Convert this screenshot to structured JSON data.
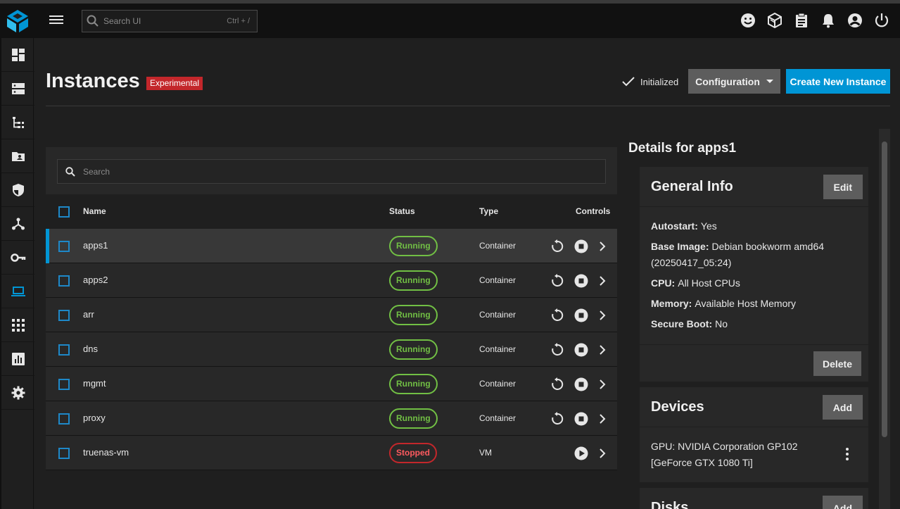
{
  "topbar": {
    "search_placeholder": "Search UI",
    "search_shortcut": "Ctrl + /"
  },
  "header": {
    "title": "Instances",
    "badge": "Experimental",
    "status": "Initialized",
    "config_button": "Configuration",
    "create_button": "Create New Instance"
  },
  "list": {
    "search_placeholder": "Search",
    "columns": {
      "name": "Name",
      "status": "Status",
      "type": "Type",
      "controls": "Controls"
    },
    "rows": [
      {
        "name": "apps1",
        "status": "Running",
        "type": "Container"
      },
      {
        "name": "apps2",
        "status": "Running",
        "type": "Container"
      },
      {
        "name": "arr",
        "status": "Running",
        "type": "Container"
      },
      {
        "name": "dns",
        "status": "Running",
        "type": "Container"
      },
      {
        "name": "mgmt",
        "status": "Running",
        "type": "Container"
      },
      {
        "name": "proxy",
        "status": "Running",
        "type": "Container"
      },
      {
        "name": "truenas-vm",
        "status": "Stopped",
        "type": "VM"
      }
    ]
  },
  "details": {
    "title": "Details for apps1",
    "general": {
      "title": "General Info",
      "edit_button": "Edit",
      "autostart_label": "Autostart:",
      "autostart_value": "Yes",
      "image_label": "Base Image:",
      "image_value": "Debian bookworm amd64 (20250417_05:24)",
      "cpu_label": "CPU:",
      "cpu_value": "All Host CPUs",
      "memory_label": "Memory:",
      "memory_value": "Available Host Memory",
      "secureboot_label": "Secure Boot:",
      "secureboot_value": "No",
      "delete_button": "Delete"
    },
    "devices": {
      "title": "Devices",
      "add_button": "Add",
      "item": "GPU: NVIDIA Corporation GP102 [GeForce GTX 1080 Ti]"
    },
    "disks": {
      "title": "Disks",
      "add_button": "Add"
    }
  },
  "colors": {
    "accent": "#0095d5",
    "running": "#71bf44",
    "stopped": "#c3272b"
  }
}
